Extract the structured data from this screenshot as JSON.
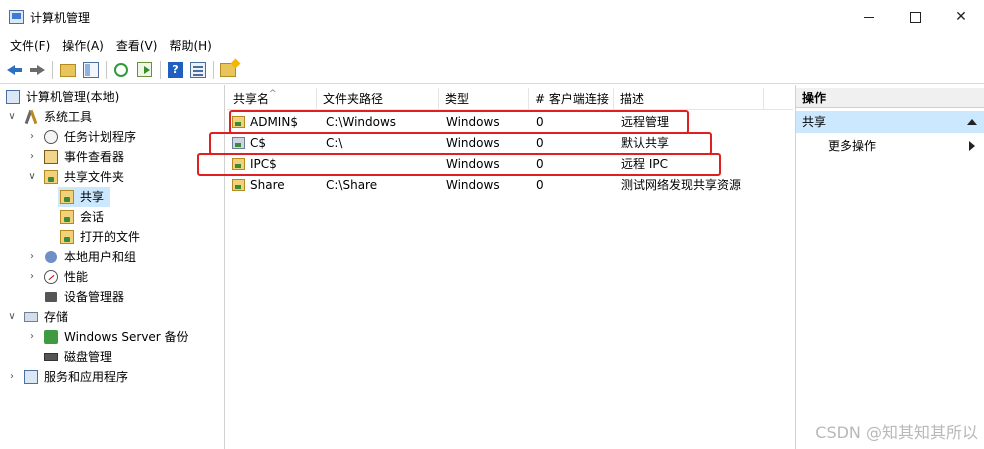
{
  "window": {
    "title": "计算机管理",
    "min_label": "",
    "max_label": "",
    "close_label": "✕"
  },
  "menu": [
    "文件(F)",
    "操作(A)",
    "查看(V)",
    "帮助(H)"
  ],
  "tree": {
    "root": "计算机管理(本地)",
    "system_tools": "系统工具",
    "task_scheduler": "任务计划程序",
    "event_viewer": "事件查看器",
    "shared_folders": "共享文件夹",
    "shares": "共享",
    "sessions": "会话",
    "open_files": "打开的文件",
    "local_users": "本地用户和组",
    "performance": "性能",
    "device_manager": "设备管理器",
    "storage": "存储",
    "backup": "Windows Server 备份",
    "disk_management": "磁盘管理",
    "services_apps": "服务和应用程序"
  },
  "list": {
    "columns": [
      "共享名",
      "文件夹路径",
      "类型",
      "# 客户端连接",
      "描述"
    ],
    "rows": [
      {
        "name": "ADMIN$",
        "path": "C:\\Windows",
        "type": "Windows",
        "clients": "0",
        "desc": "远程管理"
      },
      {
        "name": "C$",
        "path": "C:\\",
        "type": "Windows",
        "clients": "0",
        "desc": "默认共享"
      },
      {
        "name": "IPC$",
        "path": "",
        "type": "Windows",
        "clients": "0",
        "desc": "远程 IPC"
      },
      {
        "name": "Share",
        "path": "C:\\Share",
        "type": "Windows",
        "clients": "0",
        "desc": "测试网络发现共享资源"
      }
    ]
  },
  "actions": {
    "header": "操作",
    "section": "共享",
    "more": "更多操作"
  },
  "watermark": "CSDN @知其知其所以",
  "colors": {
    "highlight_box": "#e02020",
    "selection": "#cce8ff"
  }
}
